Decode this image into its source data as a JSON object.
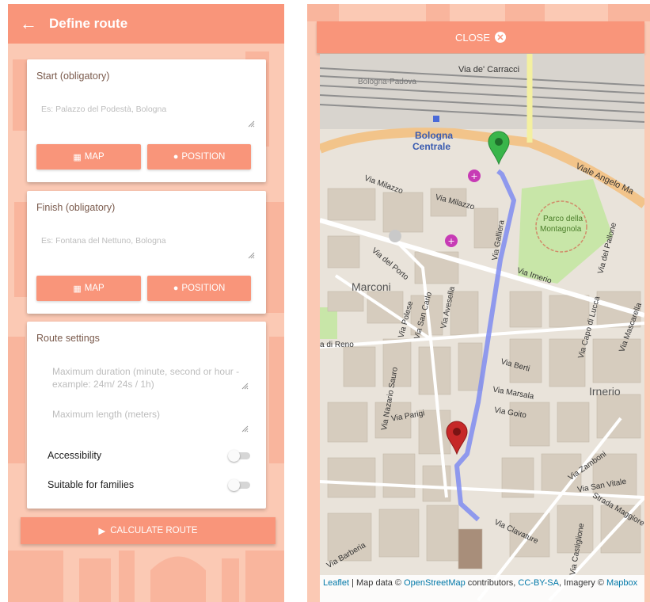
{
  "appbar": {
    "title": "Define route",
    "back_icon": "arrow-left-icon"
  },
  "start": {
    "title": "Start (obligatory)",
    "placeholder": "Es: Palazzo del Podestà, Bologna",
    "map_label": "MAP",
    "position_label": "POSITION"
  },
  "finish": {
    "title": "Finish (obligatory)",
    "placeholder": "Es: Fontana del Nettuno, Bologna",
    "map_label": "MAP",
    "position_label": "POSITION"
  },
  "settings": {
    "title": "Route settings",
    "duration_placeholder": "Maximum duration (minute, second or hour - example: 24m/ 24s / 1h)",
    "length_placeholder": "Maximum length (meters)",
    "accessibility_label": "Accessibility",
    "accessibility_on": false,
    "families_label": "Suitable for families",
    "families_on": false
  },
  "calculate_label": "CALCULATE ROUTE",
  "colors": {
    "accent": "#f9957a",
    "background": "#fbc9b4",
    "route": "#7f8cf0",
    "start_marker": "#39b54a",
    "finish_marker": "#c62828"
  },
  "map": {
    "close_label": "CLOSE",
    "labels": {
      "station": "Bologna",
      "station2": "Centrale",
      "via_carracci": "Via de' Carracci",
      "viale": "Viale Angelo Ma",
      "via_milazzo": "Via Milazzo",
      "via_milazzo2": "Via Milazzo",
      "porto_montagnola": "Parco della",
      "porto_montagnola2": "Montagnola",
      "via_del_porto": "Via del Porto",
      "marconi": "Marconi",
      "via_irnerio": "Via Irnerio",
      "via_galliera": "Via Galliera",
      "via_di_reno": "a di Reno",
      "via_polese": "Via Polese",
      "via_san_carlo": "Via San Carlo",
      "via_avesella": "Via Avesella",
      "via_berti": "Via Berti",
      "via_marsala": "Via Marsala",
      "via_goito": "Via Goito",
      "irnerio": "Irnerio",
      "via_parigi": "Via Parigi",
      "via_nazario_sauro": "Via Nazario Sauro",
      "via_capo_di_lucca": "Via Capo di Lucca",
      "via_mascarella": "Via Mascarella",
      "via_zamboni": "Via Zamboni",
      "via_san_vitale": "Via San Vitale",
      "strada_maggiore": "Strada Maggiore",
      "via_clavature": "Via Clavature",
      "via_castiglione": "Via Castiglione",
      "via_barberia": "Via Barberia",
      "via_del_pallone": "Via del Pallone",
      "via_bologna_pesaro": "Bologna-Padova"
    },
    "attribution": {
      "leaflet": "Leaflet",
      "sep1": " | Map data © ",
      "osm": "OpenStreetMap",
      "sep2": " contributors, ",
      "cc": "CC-BY-SA",
      "sep3": ", Imagery © ",
      "mapbox": "Mapbox"
    }
  }
}
